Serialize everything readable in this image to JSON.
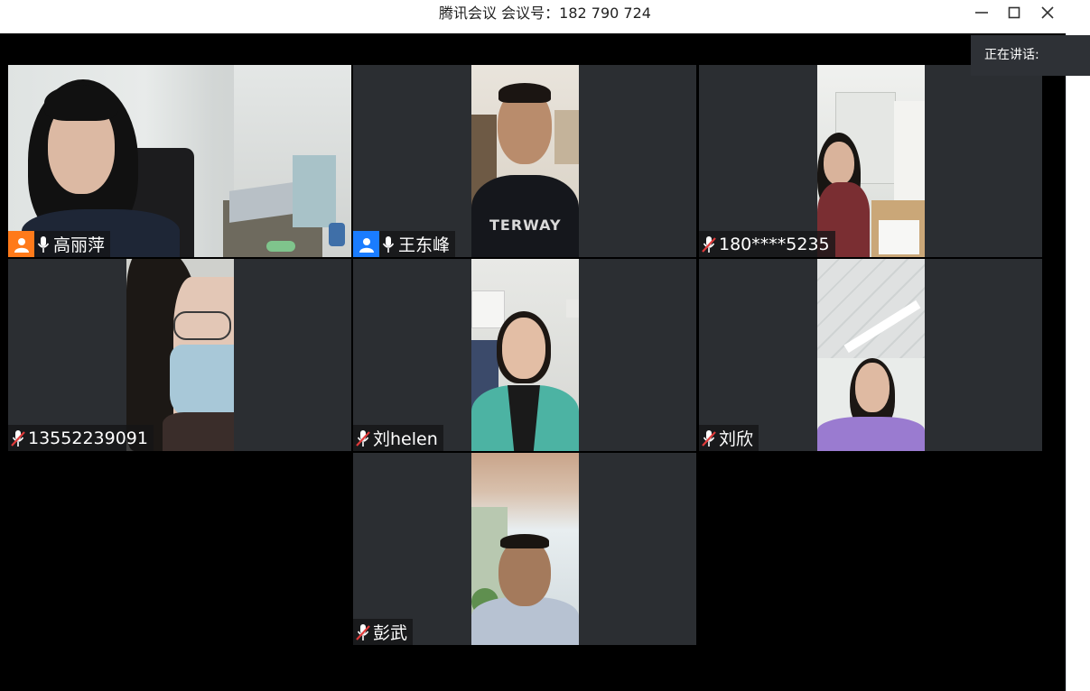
{
  "window": {
    "title": "腾讯会议 会议号：182 790 724",
    "minimize_icon": "minimize-icon",
    "maximize_icon": "maximize-icon",
    "close_icon": "close-icon"
  },
  "speaking_panel": {
    "label": "正在讲话:"
  },
  "participants": [
    {
      "name": "高丽萍",
      "host_badge_color": "#ff7a1a",
      "mic": "on"
    },
    {
      "name": "王东峰",
      "host_badge_color": "#1a7cff",
      "mic": "on"
    },
    {
      "name": "180****5235",
      "mic": "muted"
    },
    {
      "name": "13552239091",
      "mic": "muted"
    },
    {
      "name": "刘helen",
      "mic": "muted"
    },
    {
      "name": "刘欣",
      "mic": "muted"
    },
    {
      "name": "彭武",
      "mic": "muted"
    }
  ],
  "colors": {
    "stage_bg": "#000000",
    "tile_bg": "#2b2e32",
    "muted_red": "#e03a3a"
  }
}
